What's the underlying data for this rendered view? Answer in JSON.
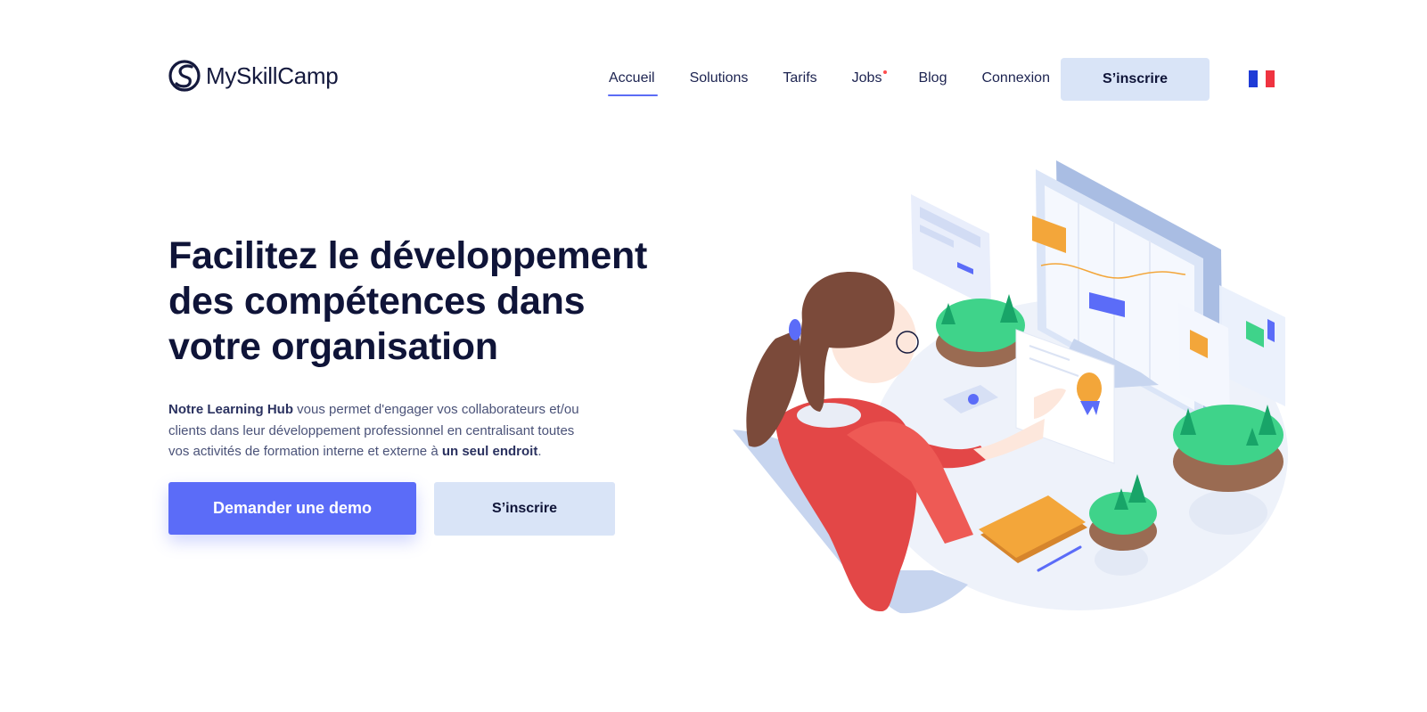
{
  "brand": {
    "name": "MySkillCamp"
  },
  "nav": {
    "items": [
      {
        "label": "Accueil",
        "active": true
      },
      {
        "label": "Solutions"
      },
      {
        "label": "Tarifs"
      },
      {
        "label": "Jobs",
        "badge_dot": true
      },
      {
        "label": "Blog"
      },
      {
        "label": "Connexion"
      }
    ],
    "cta_label": "S’inscrire",
    "language_flag": "french-flag-icon"
  },
  "hero": {
    "title": "Facilitez le développement des compétences dans votre organisation",
    "desc_strong1": "Notre Learning Hub",
    "desc_text1": " vous permet d'engager vos collaborateurs et/ou clients dans leur développement professionnel en centralisant toutes vos activités de formation interne et externe à ",
    "desc_strong2": "un seul endroit",
    "desc_text2": ".",
    "primary_button": "Demander une demo",
    "secondary_button": "S’inscrire"
  },
  "colors": {
    "accent": "#5b6cf8",
    "navy": "#0f1438",
    "light_blue": "#d9e4f7",
    "flag_blue": "#1f3bd6",
    "flag_red": "#ef3340"
  }
}
